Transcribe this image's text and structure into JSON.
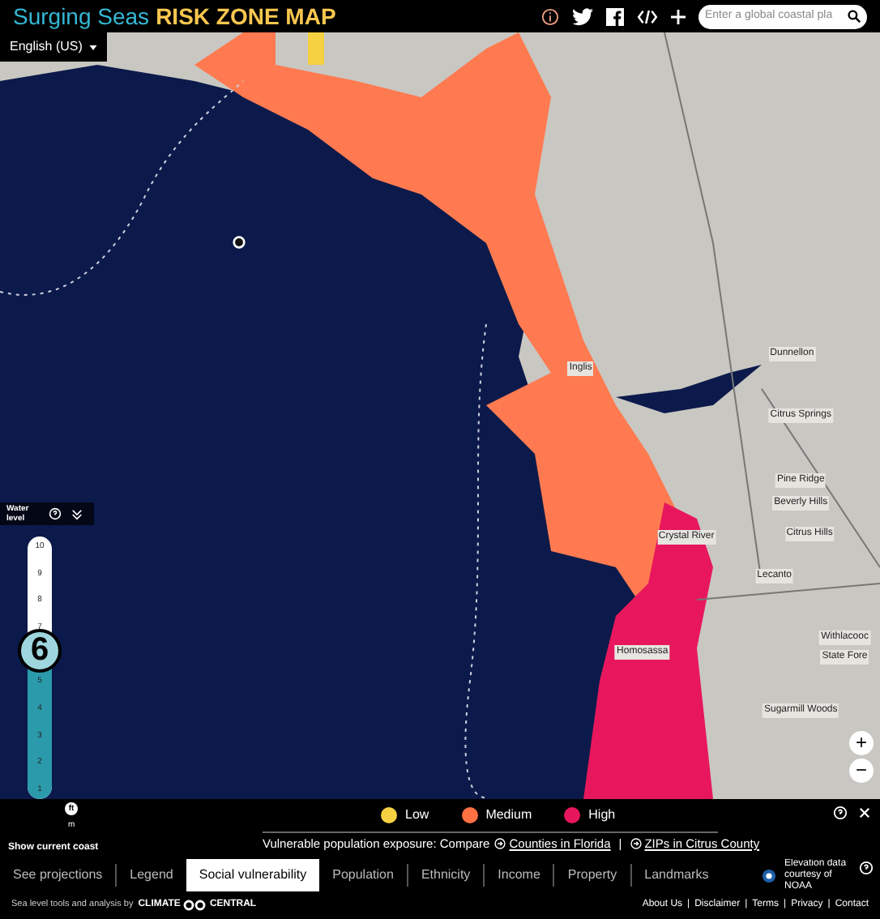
{
  "header": {
    "title_part1": "Surging Seas",
    "title_part2": "RISK ZONE MAP",
    "search": {
      "placeholder": "Enter a global coastal pla"
    },
    "language": "English (US)"
  },
  "map": {
    "labels": [
      {
        "text": "Inglis"
      },
      {
        "text": "Dunnellon"
      },
      {
        "text": "Citrus Springs"
      },
      {
        "text": "Pine Ridge"
      },
      {
        "text": "Beverly Hills"
      },
      {
        "text": "Crystal River"
      },
      {
        "text": "Citrus Hills"
      },
      {
        "text": "Lecanto"
      },
      {
        "text": "Homosassa"
      },
      {
        "text": "Withlacooc"
      },
      {
        "text": "State Fore"
      },
      {
        "text": "Sugarmill Woods"
      }
    ],
    "zoom_in": "+",
    "zoom_out": "−"
  },
  "water_level": {
    "title": "Water level",
    "ticks": [
      "10",
      "9",
      "8",
      "7",
      "5",
      "4",
      "3",
      "2",
      "1"
    ],
    "value": "6",
    "level": 0.56,
    "unit_ft": "ft",
    "unit_m": "m",
    "show_coast": "Show current coast"
  },
  "legend": {
    "items": [
      {
        "label": "Low",
        "color": "#f5d142"
      },
      {
        "label": "Medium",
        "color": "#ff7043"
      },
      {
        "label": "High",
        "color": "#e8175d"
      }
    ],
    "exposure_text": "Vulnerable population exposure: Compare",
    "links": [
      "Counties in Florida",
      "ZIPs in Citrus County"
    ],
    "separator": "|"
  },
  "tabs": [
    {
      "label": "See projections",
      "selected": false
    },
    {
      "label": "Legend",
      "selected": false
    },
    {
      "label": "Social vulnerability",
      "selected": true
    },
    {
      "label": "Population",
      "selected": false
    },
    {
      "label": "Ethnicity",
      "selected": false
    },
    {
      "label": "Income",
      "selected": false
    },
    {
      "label": "Property",
      "selected": false
    },
    {
      "label": "Landmarks",
      "selected": false
    }
  ],
  "credit": "Elevation data courtesy of NOAA",
  "footer": {
    "text": "Sea level tools and analysis by",
    "brand_left": "CLIMATE",
    "brand_right": "CENTRAL",
    "links": [
      "About Us",
      "Disclaimer",
      "Terms",
      "Privacy",
      "Contact"
    ],
    "separators": [
      "|",
      "|",
      "|",
      "|"
    ]
  }
}
